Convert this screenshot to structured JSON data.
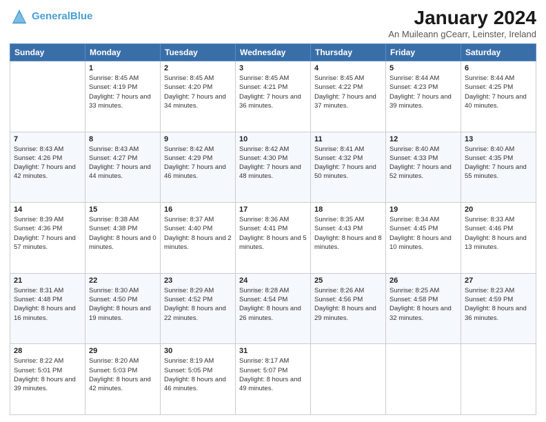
{
  "header": {
    "logo_line1": "General",
    "logo_line2": "Blue",
    "main_title": "January 2024",
    "subtitle": "An Muileann gCearr, Leinster, Ireland"
  },
  "columns": [
    "Sunday",
    "Monday",
    "Tuesday",
    "Wednesday",
    "Thursday",
    "Friday",
    "Saturday"
  ],
  "weeks": [
    [
      {
        "day": "",
        "sunrise": "",
        "sunset": "",
        "daylight": ""
      },
      {
        "day": "1",
        "sunrise": "Sunrise: 8:45 AM",
        "sunset": "Sunset: 4:19 PM",
        "daylight": "Daylight: 7 hours and 33 minutes."
      },
      {
        "day": "2",
        "sunrise": "Sunrise: 8:45 AM",
        "sunset": "Sunset: 4:20 PM",
        "daylight": "Daylight: 7 hours and 34 minutes."
      },
      {
        "day": "3",
        "sunrise": "Sunrise: 8:45 AM",
        "sunset": "Sunset: 4:21 PM",
        "daylight": "Daylight: 7 hours and 36 minutes."
      },
      {
        "day": "4",
        "sunrise": "Sunrise: 8:45 AM",
        "sunset": "Sunset: 4:22 PM",
        "daylight": "Daylight: 7 hours and 37 minutes."
      },
      {
        "day": "5",
        "sunrise": "Sunrise: 8:44 AM",
        "sunset": "Sunset: 4:23 PM",
        "daylight": "Daylight: 7 hours and 39 minutes."
      },
      {
        "day": "6",
        "sunrise": "Sunrise: 8:44 AM",
        "sunset": "Sunset: 4:25 PM",
        "daylight": "Daylight: 7 hours and 40 minutes."
      }
    ],
    [
      {
        "day": "7",
        "sunrise": "Sunrise: 8:43 AM",
        "sunset": "Sunset: 4:26 PM",
        "daylight": "Daylight: 7 hours and 42 minutes."
      },
      {
        "day": "8",
        "sunrise": "Sunrise: 8:43 AM",
        "sunset": "Sunset: 4:27 PM",
        "daylight": "Daylight: 7 hours and 44 minutes."
      },
      {
        "day": "9",
        "sunrise": "Sunrise: 8:42 AM",
        "sunset": "Sunset: 4:29 PM",
        "daylight": "Daylight: 7 hours and 46 minutes."
      },
      {
        "day": "10",
        "sunrise": "Sunrise: 8:42 AM",
        "sunset": "Sunset: 4:30 PM",
        "daylight": "Daylight: 7 hours and 48 minutes."
      },
      {
        "day": "11",
        "sunrise": "Sunrise: 8:41 AM",
        "sunset": "Sunset: 4:32 PM",
        "daylight": "Daylight: 7 hours and 50 minutes."
      },
      {
        "day": "12",
        "sunrise": "Sunrise: 8:40 AM",
        "sunset": "Sunset: 4:33 PM",
        "daylight": "Daylight: 7 hours and 52 minutes."
      },
      {
        "day": "13",
        "sunrise": "Sunrise: 8:40 AM",
        "sunset": "Sunset: 4:35 PM",
        "daylight": "Daylight: 7 hours and 55 minutes."
      }
    ],
    [
      {
        "day": "14",
        "sunrise": "Sunrise: 8:39 AM",
        "sunset": "Sunset: 4:36 PM",
        "daylight": "Daylight: 7 hours and 57 minutes."
      },
      {
        "day": "15",
        "sunrise": "Sunrise: 8:38 AM",
        "sunset": "Sunset: 4:38 PM",
        "daylight": "Daylight: 8 hours and 0 minutes."
      },
      {
        "day": "16",
        "sunrise": "Sunrise: 8:37 AM",
        "sunset": "Sunset: 4:40 PM",
        "daylight": "Daylight: 8 hours and 2 minutes."
      },
      {
        "day": "17",
        "sunrise": "Sunrise: 8:36 AM",
        "sunset": "Sunset: 4:41 PM",
        "daylight": "Daylight: 8 hours and 5 minutes."
      },
      {
        "day": "18",
        "sunrise": "Sunrise: 8:35 AM",
        "sunset": "Sunset: 4:43 PM",
        "daylight": "Daylight: 8 hours and 8 minutes."
      },
      {
        "day": "19",
        "sunrise": "Sunrise: 8:34 AM",
        "sunset": "Sunset: 4:45 PM",
        "daylight": "Daylight: 8 hours and 10 minutes."
      },
      {
        "day": "20",
        "sunrise": "Sunrise: 8:33 AM",
        "sunset": "Sunset: 4:46 PM",
        "daylight": "Daylight: 8 hours and 13 minutes."
      }
    ],
    [
      {
        "day": "21",
        "sunrise": "Sunrise: 8:31 AM",
        "sunset": "Sunset: 4:48 PM",
        "daylight": "Daylight: 8 hours and 16 minutes."
      },
      {
        "day": "22",
        "sunrise": "Sunrise: 8:30 AM",
        "sunset": "Sunset: 4:50 PM",
        "daylight": "Daylight: 8 hours and 19 minutes."
      },
      {
        "day": "23",
        "sunrise": "Sunrise: 8:29 AM",
        "sunset": "Sunset: 4:52 PM",
        "daylight": "Daylight: 8 hours and 22 minutes."
      },
      {
        "day": "24",
        "sunrise": "Sunrise: 8:28 AM",
        "sunset": "Sunset: 4:54 PM",
        "daylight": "Daylight: 8 hours and 26 minutes."
      },
      {
        "day": "25",
        "sunrise": "Sunrise: 8:26 AM",
        "sunset": "Sunset: 4:56 PM",
        "daylight": "Daylight: 8 hours and 29 minutes."
      },
      {
        "day": "26",
        "sunrise": "Sunrise: 8:25 AM",
        "sunset": "Sunset: 4:58 PM",
        "daylight": "Daylight: 8 hours and 32 minutes."
      },
      {
        "day": "27",
        "sunrise": "Sunrise: 8:23 AM",
        "sunset": "Sunset: 4:59 PM",
        "daylight": "Daylight: 8 hours and 36 minutes."
      }
    ],
    [
      {
        "day": "28",
        "sunrise": "Sunrise: 8:22 AM",
        "sunset": "Sunset: 5:01 PM",
        "daylight": "Daylight: 8 hours and 39 minutes."
      },
      {
        "day": "29",
        "sunrise": "Sunrise: 8:20 AM",
        "sunset": "Sunset: 5:03 PM",
        "daylight": "Daylight: 8 hours and 42 minutes."
      },
      {
        "day": "30",
        "sunrise": "Sunrise: 8:19 AM",
        "sunset": "Sunset: 5:05 PM",
        "daylight": "Daylight: 8 hours and 46 minutes."
      },
      {
        "day": "31",
        "sunrise": "Sunrise: 8:17 AM",
        "sunset": "Sunset: 5:07 PM",
        "daylight": "Daylight: 8 hours and 49 minutes."
      },
      {
        "day": "",
        "sunrise": "",
        "sunset": "",
        "daylight": ""
      },
      {
        "day": "",
        "sunrise": "",
        "sunset": "",
        "daylight": ""
      },
      {
        "day": "",
        "sunrise": "",
        "sunset": "",
        "daylight": ""
      }
    ]
  ]
}
